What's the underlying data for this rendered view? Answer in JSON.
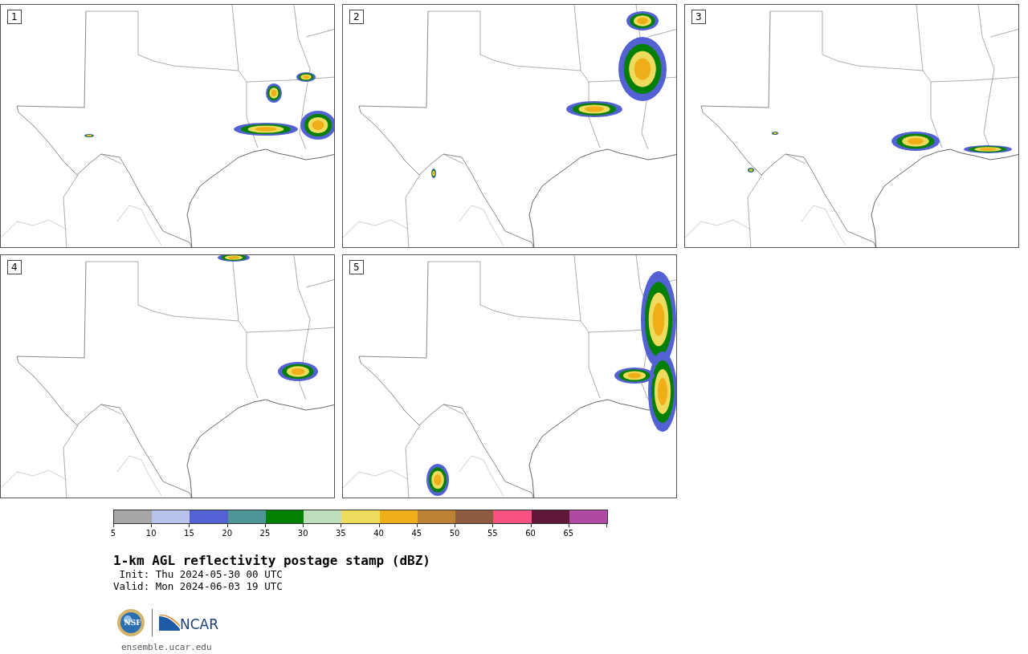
{
  "panels": [
    {
      "label": "1"
    },
    {
      "label": "2"
    },
    {
      "label": "3"
    },
    {
      "label": "4"
    },
    {
      "label": "5"
    }
  ],
  "colorbar": {
    "bins": [
      {
        "color": "#a6a6a6"
      },
      {
        "color": "#b8c2ec"
      },
      {
        "color": "#5461d4"
      },
      {
        "color": "#4f9598"
      },
      {
        "color": "#038001"
      },
      {
        "color": "#bedfbc"
      },
      {
        "color": "#efdb5d"
      },
      {
        "color": "#efaf18"
      },
      {
        "color": "#bb8233"
      },
      {
        "color": "#8b5a3f"
      },
      {
        "color": "#f75181"
      },
      {
        "color": "#601838"
      },
      {
        "color": "#ae4aa4"
      }
    ],
    "ticks": [
      "5",
      "10",
      "15",
      "20",
      "25",
      "30",
      "35",
      "40",
      "45",
      "50",
      "55",
      "60",
      "65"
    ]
  },
  "title": "1-km AGL reflectivity postage stamp (dBZ)",
  "init": " Init: Thu 2024-05-30 00 UTC",
  "valid": "Valid: Mon 2024-06-03 19 UTC",
  "seal_text": "NSF",
  "logo_text": "NCAR",
  "link": "ensemble.ucar.edu"
}
